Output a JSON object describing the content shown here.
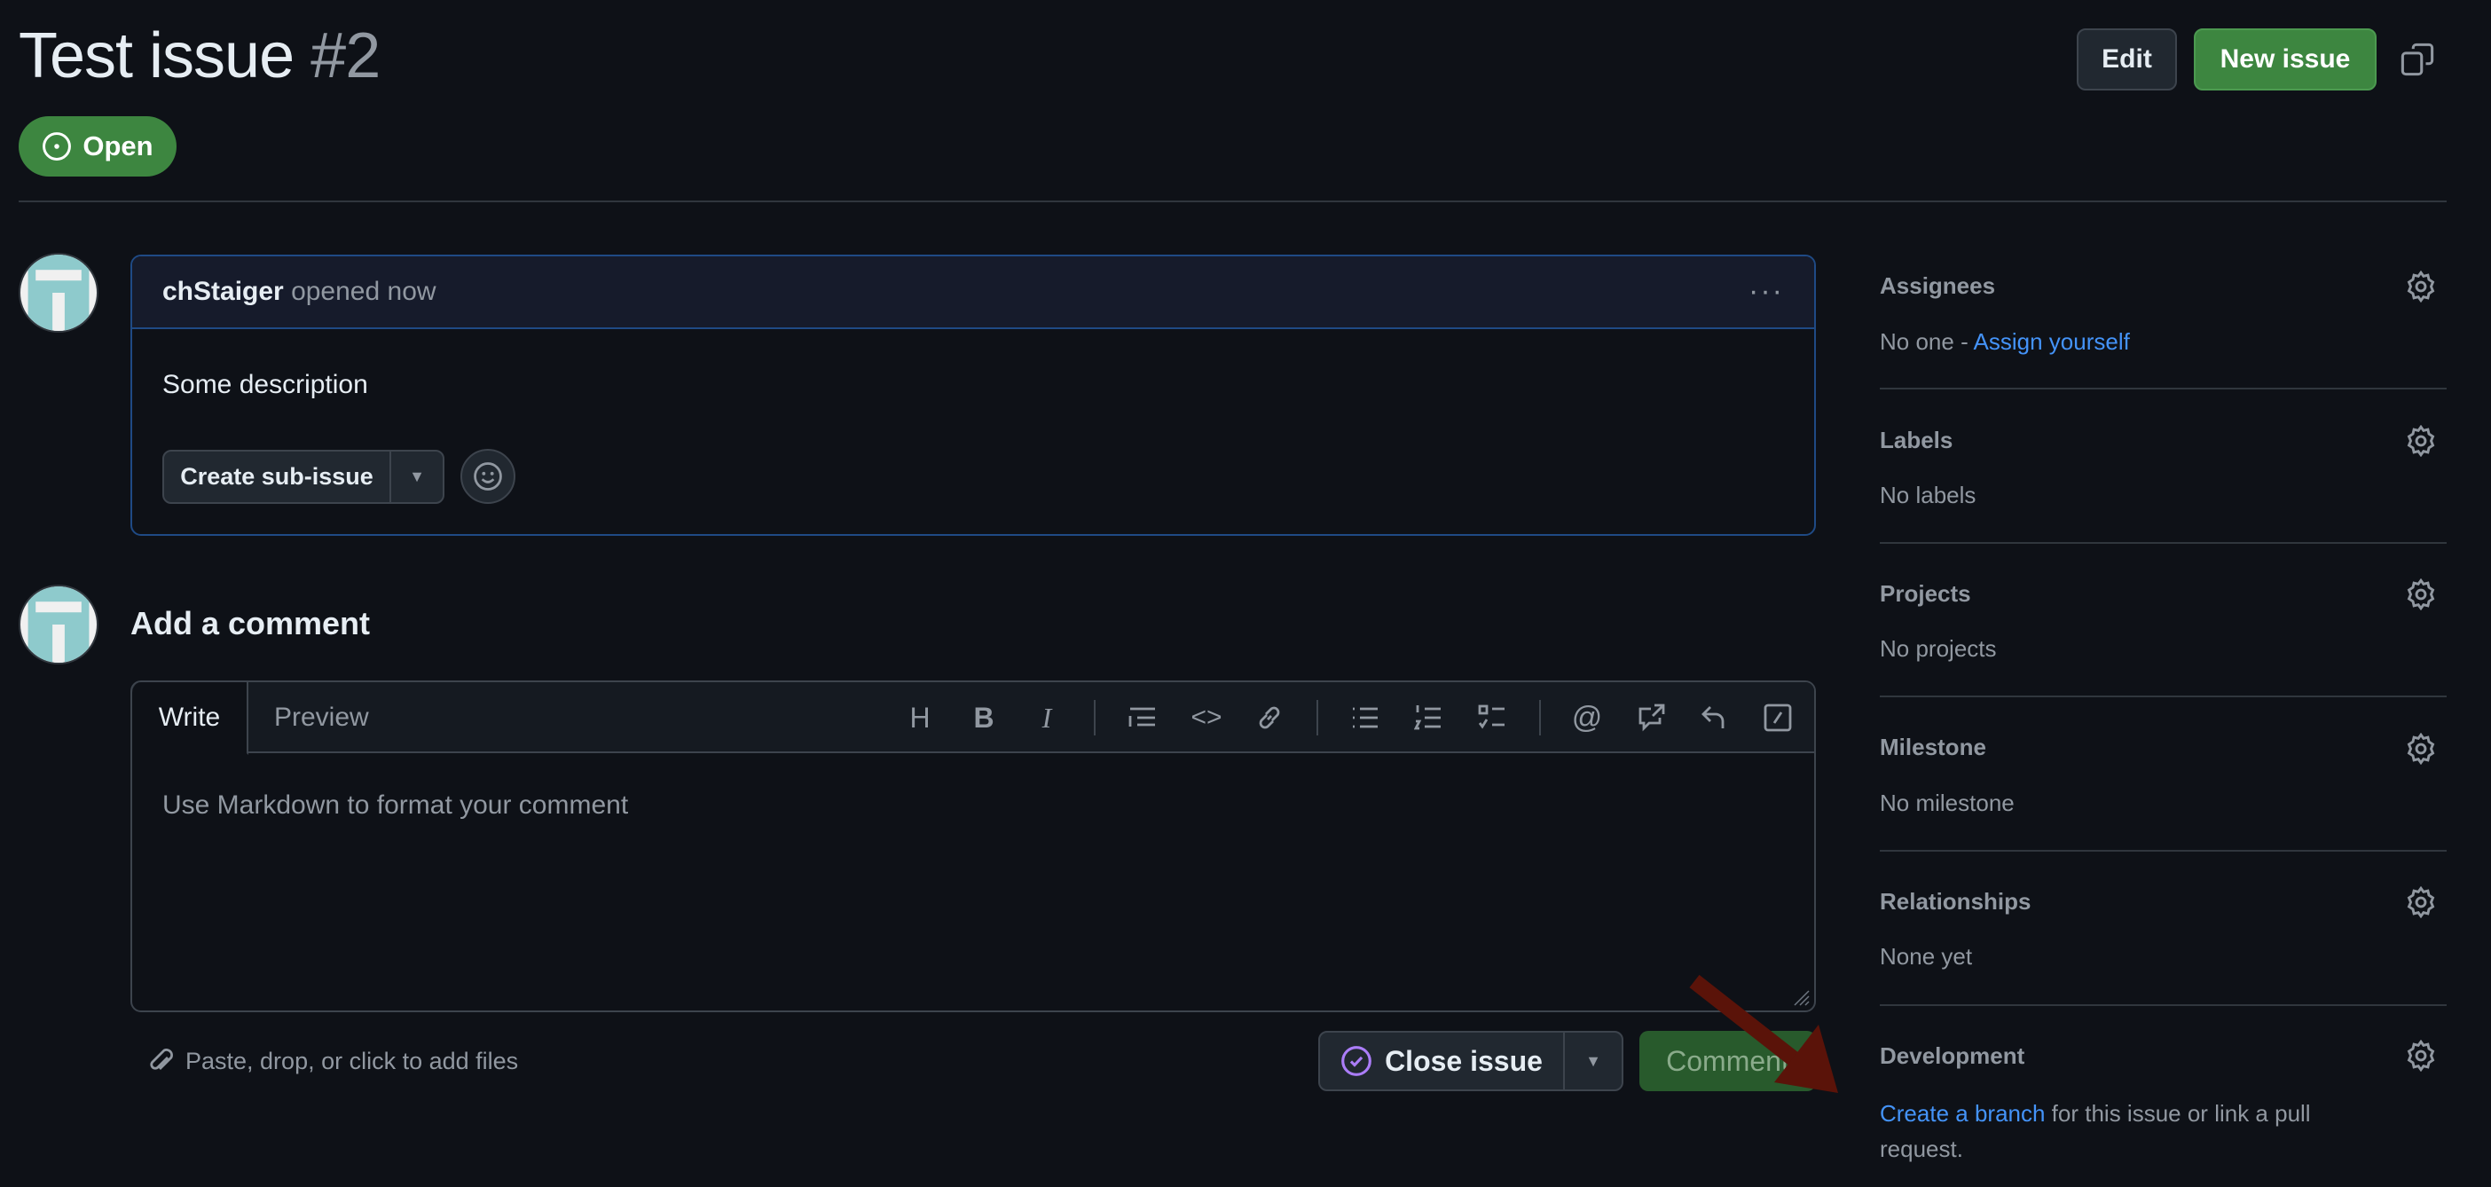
{
  "header": {
    "title": "Test issue",
    "number": "#2",
    "status": "Open",
    "edit_label": "Edit",
    "new_issue_label": "New issue"
  },
  "comment": {
    "author": "chStaiger",
    "action": "opened now",
    "body": "Some description",
    "sub_issue_label": "Create sub-issue"
  },
  "composer": {
    "heading": "Add a comment",
    "tabs": [
      "Write",
      "Preview"
    ],
    "placeholder": "Use Markdown to format your comment",
    "attach_hint": "Paste, drop, or click to add files",
    "close_label": "Close issue",
    "comment_label": "Comment"
  },
  "toolbar": [
    "heading-icon",
    "bold-icon",
    "italic-icon",
    "quote-icon",
    "code-icon",
    "link-icon",
    "unordered-list-icon",
    "ordered-list-icon",
    "task-list-icon",
    "mention-icon",
    "cross-reference-icon",
    "saved-reply-icon",
    "slash-command-icon"
  ],
  "sidebar": [
    {
      "title": "Assignees",
      "value": "No one - ",
      "link": "Assign yourself"
    },
    {
      "title": "Labels",
      "value": "No labels"
    },
    {
      "title": "Projects",
      "value": "No projects"
    },
    {
      "title": "Milestone",
      "value": "No milestone"
    },
    {
      "title": "Relationships",
      "value": "None yet"
    },
    {
      "title": "Development",
      "link": "Create a branch",
      "value": " for this issue or link a pull request."
    }
  ],
  "colors": {
    "background": "#0e1117",
    "accent_green": "#3d8640",
    "link": "#4493f8",
    "annotation_arrow": "#5a1309"
  }
}
